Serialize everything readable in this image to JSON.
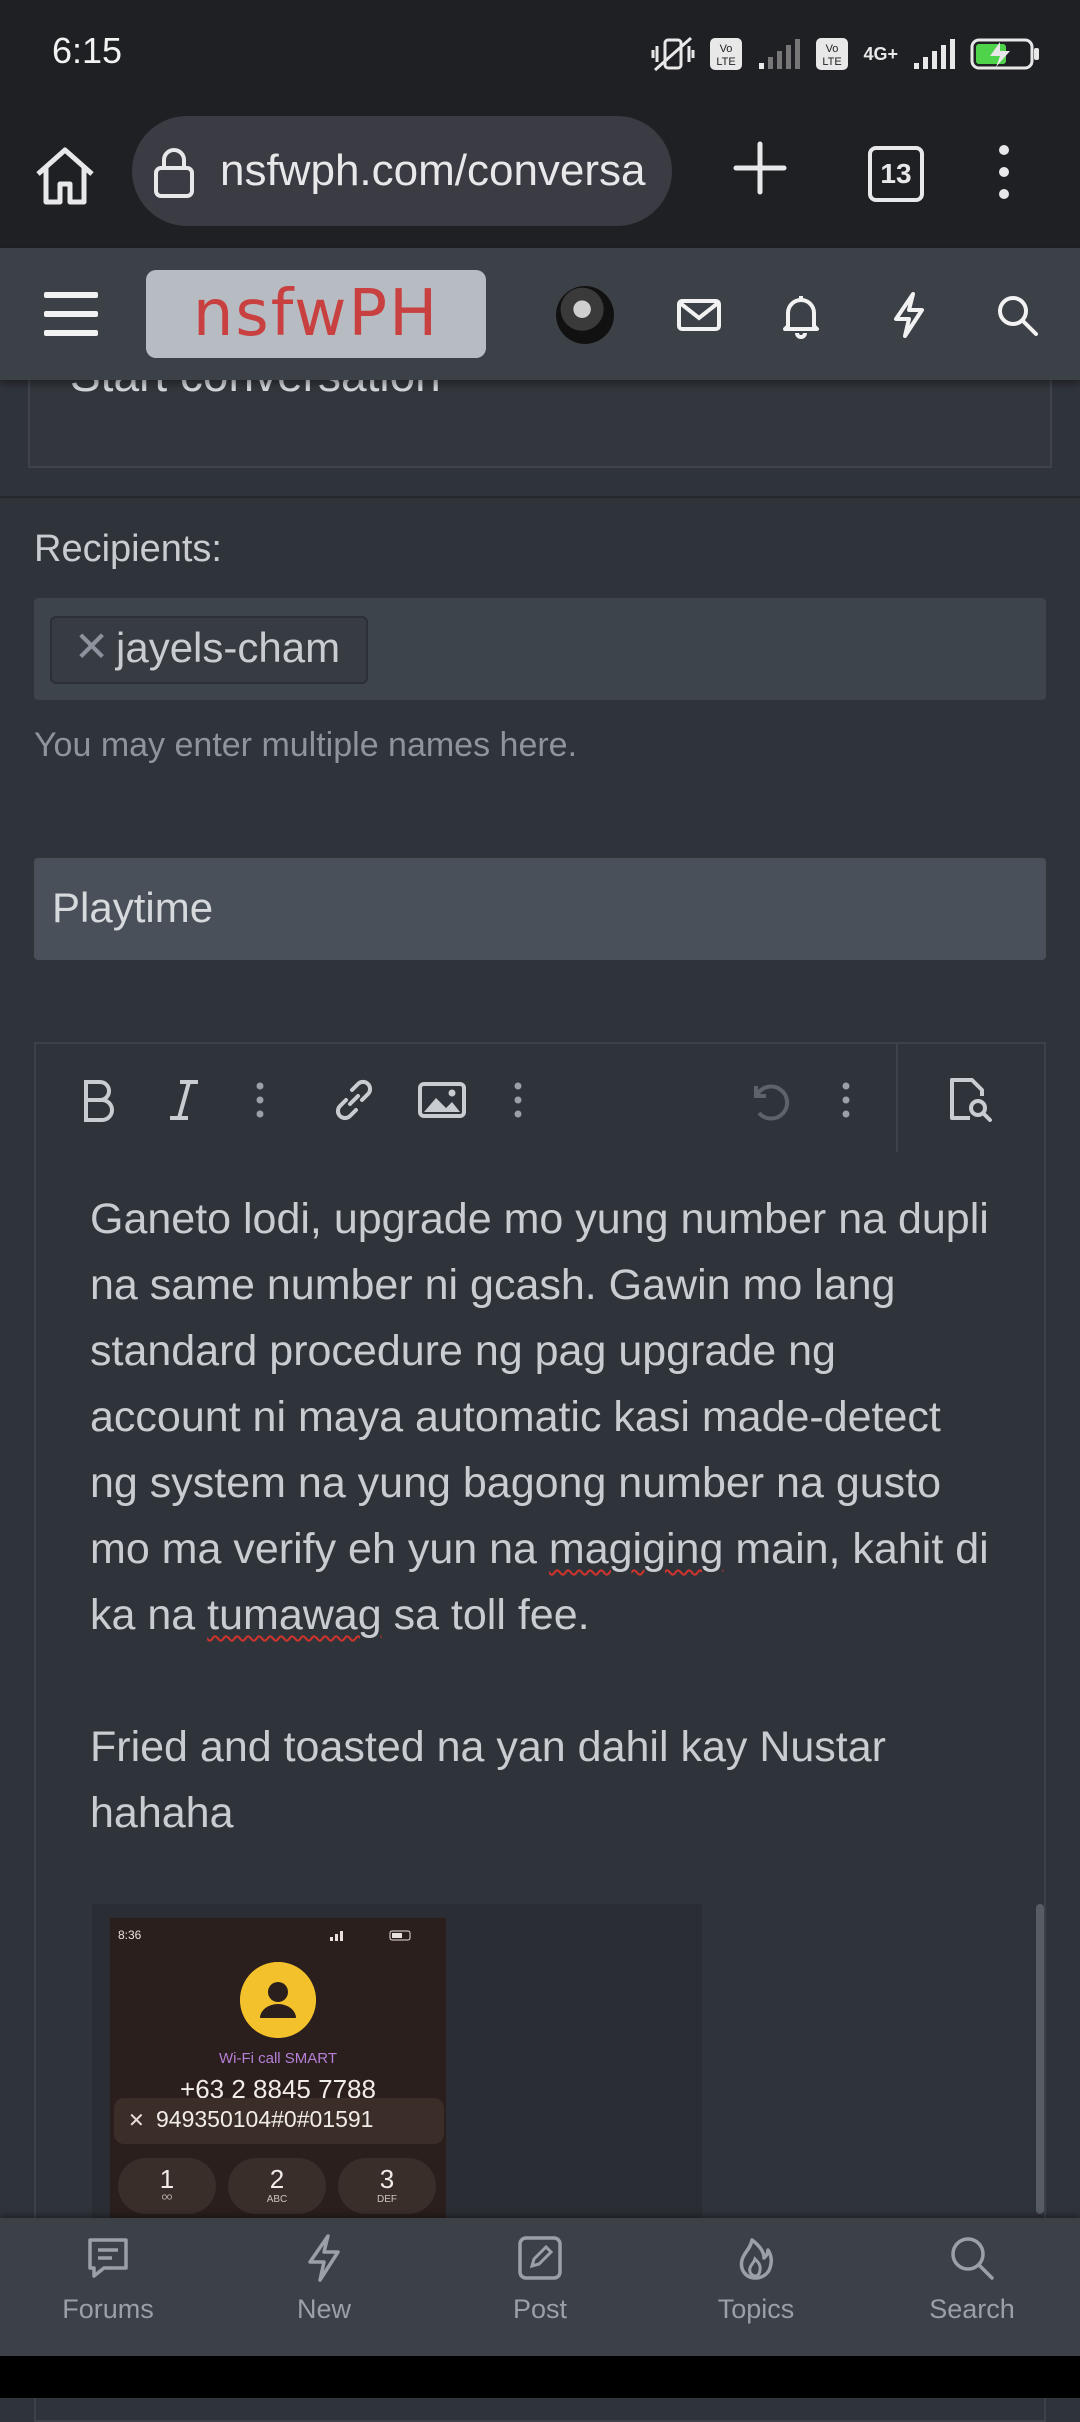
{
  "status_bar": {
    "time": "6:15",
    "network": "4G+"
  },
  "browser": {
    "url": "nsfwph.com/conversa",
    "tab_count": "13"
  },
  "site": {
    "logo_text": "nsfwPH"
  },
  "page": {
    "title_partial": "Start conversation"
  },
  "form": {
    "recipients_label": "Recipients:",
    "recipient_token": "jayels-cham",
    "recipient_remove": "✕",
    "recipients_hint": "You may enter multiple names here.",
    "title_value": "Playtime",
    "body_paragraph_1": "Ganeto lodi, upgrade mo yung number na dupli na same number ni gcash. Gawin mo lang standard procedure ng pag upgrade ng account ni maya automatic kasi made-detect ng system na yung bagong number na gusto mo ma verify eh yun na",
    "body_word_magiging": "magiging",
    "body_paragraph_1b": " main, kahit di ka na ",
    "body_word_tumawag": "tumawag",
    "body_paragraph_1c": " sa toll fee.",
    "body_paragraph_2": "Fried and toasted na yan dahil kay Nustar hahaha"
  },
  "attachment": {
    "time": "8:36",
    "label": "Wi-Fi call SMART",
    "number": "+63 2 8845 7788",
    "dial_close": "✕",
    "dial_input": "949350104#0#01591",
    "keys": [
      {
        "num": "1",
        "sub": "ᴼᴼ"
      },
      {
        "num": "2",
        "sub": "ABC"
      },
      {
        "num": "3",
        "sub": "DEF"
      }
    ]
  },
  "bottom_nav": [
    {
      "label": "Forums",
      "icon": "forums-icon"
    },
    {
      "label": "New",
      "icon": "bolt-icon"
    },
    {
      "label": "Post",
      "icon": "post-icon"
    },
    {
      "label": "Topics",
      "icon": "fire-icon"
    },
    {
      "label": "Search",
      "icon": "search-icon"
    }
  ],
  "colors": {
    "accent_logo": "#c94040",
    "header_bg": "#3c4148",
    "page_bg": "#2f333a"
  }
}
